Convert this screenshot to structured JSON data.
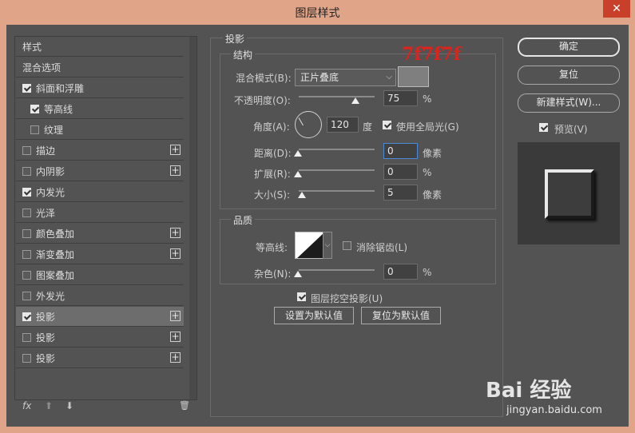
{
  "window": {
    "title": "图层样式",
    "close_label": "✕"
  },
  "sidebar": {
    "items": [
      {
        "label": "样式",
        "checkbox": null,
        "plus": false,
        "selected": false
      },
      {
        "label": "混合选项",
        "checkbox": null,
        "plus": false,
        "selected": false
      },
      {
        "label": "斜面和浮雕",
        "checkbox": true,
        "plus": false,
        "selected": false
      },
      {
        "label": "等高线",
        "checkbox": true,
        "plus": false,
        "selected": false,
        "indent": true
      },
      {
        "label": "纹理",
        "checkbox": false,
        "plus": false,
        "selected": false,
        "indent": true
      },
      {
        "label": "描边",
        "checkbox": false,
        "plus": true,
        "selected": false
      },
      {
        "label": "内阴影",
        "checkbox": false,
        "plus": true,
        "selected": false
      },
      {
        "label": "内发光",
        "checkbox": true,
        "plus": false,
        "selected": false
      },
      {
        "label": "光泽",
        "checkbox": false,
        "plus": false,
        "selected": false
      },
      {
        "label": "颜色叠加",
        "checkbox": false,
        "plus": true,
        "selected": false
      },
      {
        "label": "渐变叠加",
        "checkbox": false,
        "plus": true,
        "selected": false
      },
      {
        "label": "图案叠加",
        "checkbox": false,
        "plus": false,
        "selected": false
      },
      {
        "label": "外发光",
        "checkbox": false,
        "plus": false,
        "selected": false
      },
      {
        "label": "投影",
        "checkbox": true,
        "plus": true,
        "selected": true
      },
      {
        "label": "投影",
        "checkbox": false,
        "plus": true,
        "selected": false
      },
      {
        "label": "投影",
        "checkbox": false,
        "plus": true,
        "selected": false
      }
    ],
    "tools": {
      "fx": "fx",
      "up": "⬆",
      "down": "⬇",
      "trash": "🗑"
    }
  },
  "shadow": {
    "group_title": "投影",
    "structure": {
      "title": "结构",
      "blend_mode_label": "混合模式(B):",
      "blend_mode_value": "正片叠底",
      "color_hex_note": "7f7f7f",
      "color_swatch": "#7f7f7f",
      "opacity_label": "不透明度(O):",
      "opacity_value": "75",
      "opacity_unit": "%",
      "angle_label": "角度(A):",
      "angle_value": "120",
      "angle_unit": "度",
      "global_light_label": "使用全局光(G)",
      "distance_label": "距离(D):",
      "distance_value": "0",
      "distance_unit": "像素",
      "spread_label": "扩展(R):",
      "spread_value": "0",
      "spread_unit": "%",
      "size_label": "大小(S):",
      "size_value": "5",
      "size_unit": "像素"
    },
    "quality": {
      "title": "品质",
      "contour_label": "等高线:",
      "antialias_label": "消除锯齿(L)",
      "noise_label": "杂色(N):",
      "noise_value": "0",
      "noise_unit": "%"
    },
    "knockout_label": "图层挖空投影(U)",
    "set_default_label": "设置为默认值",
    "reset_default_label": "复位为默认值"
  },
  "right": {
    "ok_label": "确定",
    "reset_label": "复位",
    "new_style_label": "新建样式(W)...",
    "preview_label": "预览(V)"
  },
  "watermark": {
    "brand": "Bai 经验",
    "url": "jingyan.baidu.com"
  }
}
